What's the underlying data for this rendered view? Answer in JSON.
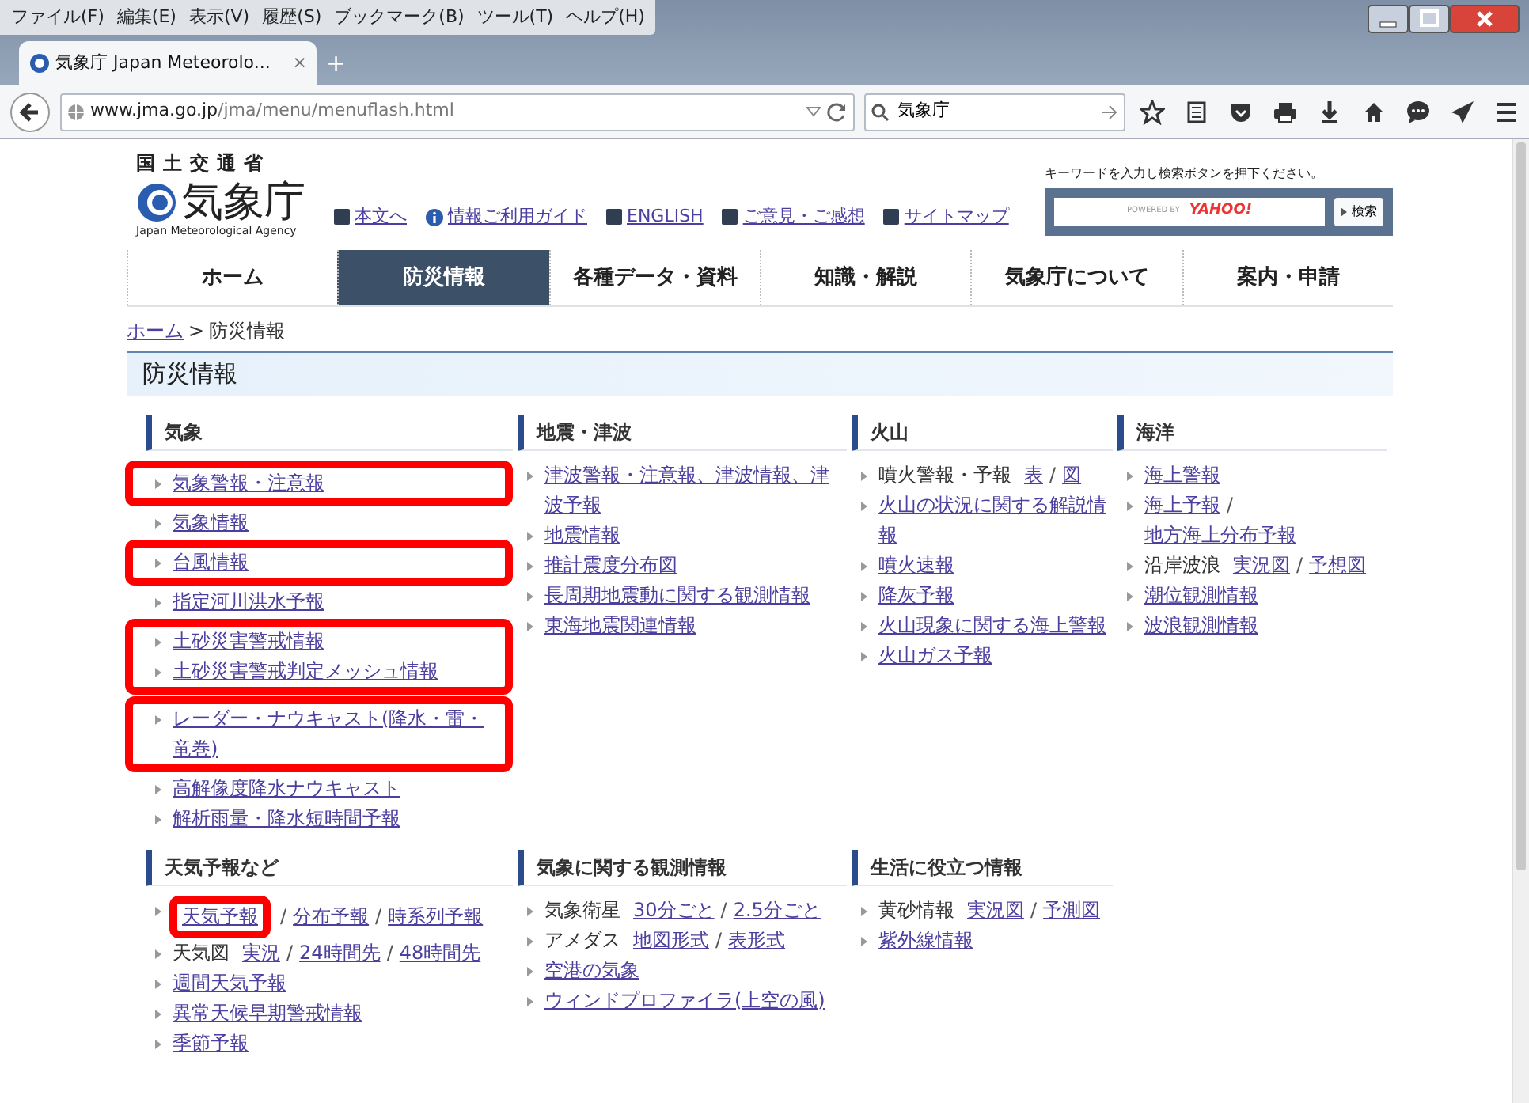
{
  "browser": {
    "menu": [
      "ファイル(F)",
      "編集(E)",
      "表示(V)",
      "履歴(S)",
      "ブックマーク(B)",
      "ツール(T)",
      "ヘルプ(H)"
    ],
    "tab": {
      "title": "気象庁 Japan Meteorolo...",
      "close": "×"
    },
    "new_tab": "+",
    "url_host": "www.jma.go.jp",
    "url_path": "/jma/menu/menuflash.html",
    "search": {
      "value": "気象庁"
    }
  },
  "site": {
    "ministry": "国土交通省",
    "logo": "気象庁",
    "logo_en": "Japan Meteorological Agency",
    "util_links": [
      {
        "kind": "box",
        "text": "本文へ"
      },
      {
        "kind": "info",
        "text": "情報ご利用ガイド"
      },
      {
        "kind": "box",
        "text": "ENGLISH"
      },
      {
        "kind": "box",
        "text": "ご意見・ご感想"
      },
      {
        "kind": "box",
        "text": "サイトマップ"
      }
    ],
    "search_hint": "キーワードを入力し検索ボタンを押下ください。",
    "search_powered": "POWERED BY",
    "search_brand": "YAHOO!",
    "search_button": "検索",
    "nav": [
      {
        "label": "ホーム",
        "selected": false
      },
      {
        "label": "防災情報",
        "selected": true
      },
      {
        "label": "各種データ・資料",
        "selected": false
      },
      {
        "label": "知識・解説",
        "selected": false
      },
      {
        "label": "気象庁について",
        "selected": false
      },
      {
        "label": "案内・申請",
        "selected": false
      }
    ],
    "breadcrumb": [
      {
        "kind": "link",
        "text": "ホーム"
      },
      {
        "kind": "sep",
        "text": ">"
      },
      {
        "kind": "current",
        "text": "防災情報"
      }
    ],
    "page_title": "防災情報",
    "section_rows": [
      [
        {
          "title": "気象",
          "items": [
            {
              "kind": "highlight",
              "items": [
                {
                  "kind": "item",
                  "parts": [
                    {
                      "kind": "link",
                      "text": "気象警報・注意報"
                    }
                  ]
                }
              ]
            },
            {
              "kind": "item",
              "parts": [
                {
                  "kind": "link",
                  "text": "気象情報"
                }
              ]
            },
            {
              "kind": "highlight",
              "items": [
                {
                  "kind": "item",
                  "parts": [
                    {
                      "kind": "link",
                      "text": "台風情報"
                    }
                  ]
                }
              ]
            },
            {
              "kind": "item",
              "parts": [
                {
                  "kind": "link",
                  "text": "指定河川洪水予報"
                }
              ]
            },
            {
              "kind": "highlight",
              "items": [
                {
                  "kind": "item",
                  "parts": [
                    {
                      "kind": "link",
                      "text": "土砂災害警戒情報"
                    }
                  ]
                },
                {
                  "kind": "item",
                  "parts": [
                    {
                      "kind": "link",
                      "text": "土砂災害警戒判定メッシュ情報"
                    }
                  ]
                }
              ]
            },
            {
              "kind": "highlight",
              "items": [
                {
                  "kind": "item",
                  "parts": [
                    {
                      "kind": "link",
                      "text": "レーダー・ナウキャスト(降水・雷・竜巻)"
                    }
                  ]
                }
              ]
            },
            {
              "kind": "item",
              "parts": [
                {
                  "kind": "link",
                  "text": "高解像度降水ナウキャスト"
                }
              ]
            },
            {
              "kind": "item",
              "parts": [
                {
                  "kind": "link",
                  "text": "解析雨量・降水短時間予報"
                }
              ]
            }
          ]
        },
        {
          "title": "地震・津波",
          "items": [
            {
              "kind": "item",
              "parts": [
                {
                  "kind": "link",
                  "text": "津波警報・注意報、津波情報、津波予報"
                }
              ]
            },
            {
              "kind": "item",
              "parts": [
                {
                  "kind": "link",
                  "text": "地震情報"
                }
              ]
            },
            {
              "kind": "item",
              "parts": [
                {
                  "kind": "link",
                  "text": "推計震度分布図"
                }
              ]
            },
            {
              "kind": "item",
              "parts": [
                {
                  "kind": "link",
                  "text": "長周期地震動に関する観測情報"
                }
              ]
            },
            {
              "kind": "item",
              "parts": [
                {
                  "kind": "link",
                  "text": "東海地震関連情報"
                }
              ]
            }
          ]
        },
        {
          "title": "火山",
          "items": [
            {
              "kind": "item",
              "parts": [
                {
                  "kind": "label",
                  "text": "噴火警報・予報"
                },
                {
                  "kind": "link",
                  "text": "表"
                },
                {
                  "kind": "sep",
                  "text": "/"
                },
                {
                  "kind": "link",
                  "text": "図"
                }
              ]
            },
            {
              "kind": "item",
              "parts": [
                {
                  "kind": "link",
                  "text": "火山の状況に関する解説情報"
                }
              ]
            },
            {
              "kind": "item",
              "parts": [
                {
                  "kind": "link",
                  "text": "噴火速報"
                }
              ]
            },
            {
              "kind": "item",
              "parts": [
                {
                  "kind": "link",
                  "text": "降灰予報"
                }
              ]
            },
            {
              "kind": "item",
              "parts": [
                {
                  "kind": "link",
                  "text": "火山現象に関する海上警報"
                }
              ]
            },
            {
              "kind": "item",
              "parts": [
                {
                  "kind": "link",
                  "text": "火山ガス予報"
                }
              ]
            }
          ]
        },
        {
          "title": "海洋",
          "items": [
            {
              "kind": "item",
              "parts": [
                {
                  "kind": "link",
                  "text": "海上警報"
                }
              ]
            },
            {
              "kind": "item",
              "parts": [
                {
                  "kind": "link",
                  "text": "海上予報"
                },
                {
                  "kind": "sep",
                  "text": "/"
                },
                {
                  "kind": "link",
                  "text": "地方海上分布予報"
                }
              ]
            },
            {
              "kind": "item",
              "parts": [
                {
                  "kind": "label",
                  "text": "沿岸波浪"
                },
                {
                  "kind": "link",
                  "text": "実況図"
                },
                {
                  "kind": "sep",
                  "text": "/"
                },
                {
                  "kind": "link",
                  "text": "予想図"
                }
              ]
            },
            {
              "kind": "item",
              "parts": [
                {
                  "kind": "link",
                  "text": "潮位観測情報"
                }
              ]
            },
            {
              "kind": "item",
              "parts": [
                {
                  "kind": "link",
                  "text": "波浪観測情報"
                }
              ]
            }
          ]
        }
      ],
      [
        {
          "title": "天気予報など",
          "items": [
            {
              "kind": "item",
              "parts": [
                {
                  "kind": "highlight",
                  "parts": [
                    {
                      "kind": "link",
                      "text": "天気予報"
                    }
                  ]
                },
                {
                  "kind": "sep",
                  "text": "/"
                },
                {
                  "kind": "link",
                  "text": "分布予報"
                },
                {
                  "kind": "sep",
                  "text": "/"
                },
                {
                  "kind": "link",
                  "text": "時系列予報"
                }
              ]
            },
            {
              "kind": "item",
              "parts": [
                {
                  "kind": "label",
                  "text": "天気図"
                },
                {
                  "kind": "link",
                  "text": "実況"
                },
                {
                  "kind": "sep",
                  "text": "/"
                },
                {
                  "kind": "link",
                  "text": "24時間先"
                },
                {
                  "kind": "sep",
                  "text": "/"
                },
                {
                  "kind": "link",
                  "text": "48時間先"
                }
              ]
            },
            {
              "kind": "item",
              "parts": [
                {
                  "kind": "link",
                  "text": "週間天気予報"
                }
              ]
            },
            {
              "kind": "item",
              "parts": [
                {
                  "kind": "link",
                  "text": "異常天候早期警戒情報"
                }
              ]
            },
            {
              "kind": "item",
              "parts": [
                {
                  "kind": "link",
                  "text": "季節予報"
                }
              ]
            }
          ]
        },
        {
          "title": "気象に関する観測情報",
          "items": [
            {
              "kind": "item",
              "parts": [
                {
                  "kind": "label",
                  "text": "気象衛星"
                },
                {
                  "kind": "link",
                  "text": "30分ごと"
                },
                {
                  "kind": "sep",
                  "text": "/"
                },
                {
                  "kind": "link",
                  "text": "2.5分ごと"
                }
              ]
            },
            {
              "kind": "item",
              "parts": [
                {
                  "kind": "label",
                  "text": "アメダス"
                },
                {
                  "kind": "link",
                  "text": "地図形式"
                },
                {
                  "kind": "sep",
                  "text": "/"
                },
                {
                  "kind": "link",
                  "text": "表形式"
                }
              ]
            },
            {
              "kind": "item",
              "parts": [
                {
                  "kind": "link",
                  "text": "空港の気象"
                }
              ]
            },
            {
              "kind": "item",
              "parts": [
                {
                  "kind": "link",
                  "text": "ウィンドプロファイラ(上空の風)"
                }
              ]
            }
          ]
        },
        {
          "title": "生活に役立つ情報",
          "items": [
            {
              "kind": "item",
              "parts": [
                {
                  "kind": "label",
                  "text": "黄砂情報"
                },
                {
                  "kind": "link",
                  "text": "実況図"
                },
                {
                  "kind": "sep",
                  "text": "/"
                },
                {
                  "kind": "link",
                  "text": "予測図"
                }
              ]
            },
            {
              "kind": "item",
              "parts": [
                {
                  "kind": "link",
                  "text": "紫外線情報"
                }
              ]
            }
          ]
        }
      ]
    ]
  }
}
